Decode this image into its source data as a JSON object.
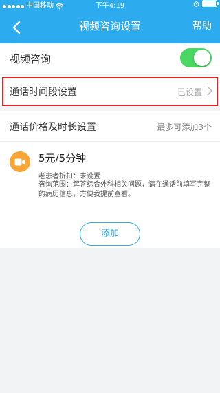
{
  "status_bar": {
    "carrier": "中国移动",
    "time": "下午4:19"
  },
  "nav": {
    "title": "视频咨询设置",
    "help_label": "帮助"
  },
  "video_consult": {
    "label": "视频咨询",
    "enabled": true
  },
  "time_slot": {
    "label": "通话时间段设置",
    "status": "已设置"
  },
  "price_duration": {
    "label": "通话价格及时长设置",
    "hint": "最多可添加3个",
    "item": {
      "price": "5元/5分钟",
      "discount": "老患者折扣：未设置",
      "scope": "咨询范围：解答综合外科相关问题，请在通话前填写完整的病历信息，方便我提前查看。"
    },
    "add_label": "添加"
  },
  "colors": {
    "primary": "#2cabee",
    "toggle_on": "#4bd763",
    "highlight": "#e82222",
    "video_icon": "#f7a534"
  }
}
